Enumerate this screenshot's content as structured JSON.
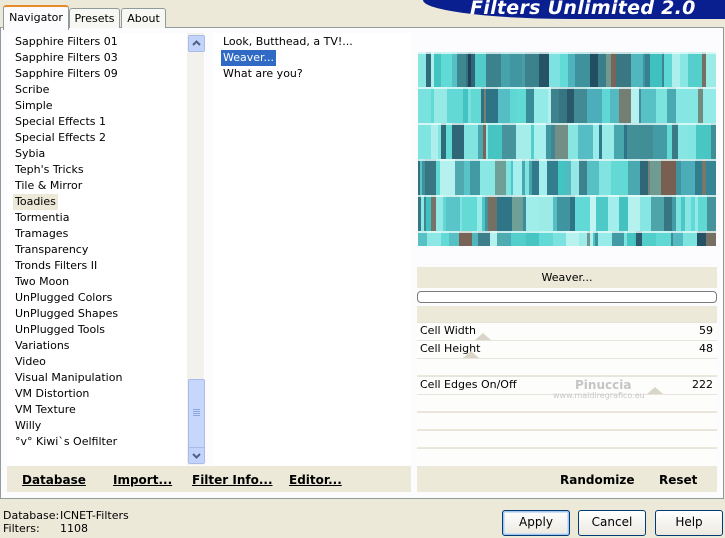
{
  "header": {
    "logo_text": "Filters Unlimited 2.0"
  },
  "tabs": [
    {
      "label": "Navigator",
      "active": true
    },
    {
      "label": "Presets",
      "active": false
    },
    {
      "label": "About",
      "active": false
    }
  ],
  "categories": [
    "Sapphire Filters 01",
    "Sapphire Filters 03",
    "Sapphire Filters 09",
    "Scribe",
    "Simple",
    "Special Effects 1",
    "Special Effects 2",
    "Sybia",
    "Teph's Tricks",
    "Tile & Mirror",
    "Toadies",
    "Tormentia",
    "Tramages",
    "Transparency",
    "Tronds Filters II",
    "Two Moon",
    "UnPlugged Colors",
    "UnPlugged Shapes",
    "UnPlugged Tools",
    "Variations",
    "Video",
    "Visual Manipulation",
    "VM Distortion",
    "VM Texture",
    "Willy",
    "°v° Kiwi`s Oelfilter"
  ],
  "selected_category": "Toadies",
  "filters": [
    "Look, Butthead, a TV!...",
    "Weaver...",
    "What are you?"
  ],
  "selected_filter": "Weaver...",
  "current_filter_name": "Weaver...",
  "parameters": [
    {
      "label": "Cell Width",
      "value": "59"
    },
    {
      "label": "Cell Height",
      "value": "48"
    },
    {
      "label": "Cell Edges On/Off",
      "value": "222"
    }
  ],
  "watermark": {
    "line1": "Pinuccia",
    "line2": "www.maldiregrafico.eu"
  },
  "toolbar_left": {
    "database": "Database",
    "import": "Import...",
    "filter_info": "Filter Info...",
    "editor": "Editor..."
  },
  "toolbar_right": {
    "randomize": "Randomize",
    "reset": "Reset"
  },
  "status": {
    "database_label": "Database:",
    "database_value": "ICNET-Filters",
    "filters_label": "Filters:",
    "filters_value": "1108"
  },
  "buttons": {
    "apply": "Apply",
    "cancel": "Cancel",
    "help": "Help"
  },
  "colors": {
    "accent": "#316ac5",
    "logo_bg": "#0a1f8f",
    "preview_base": "#67ddd9"
  }
}
